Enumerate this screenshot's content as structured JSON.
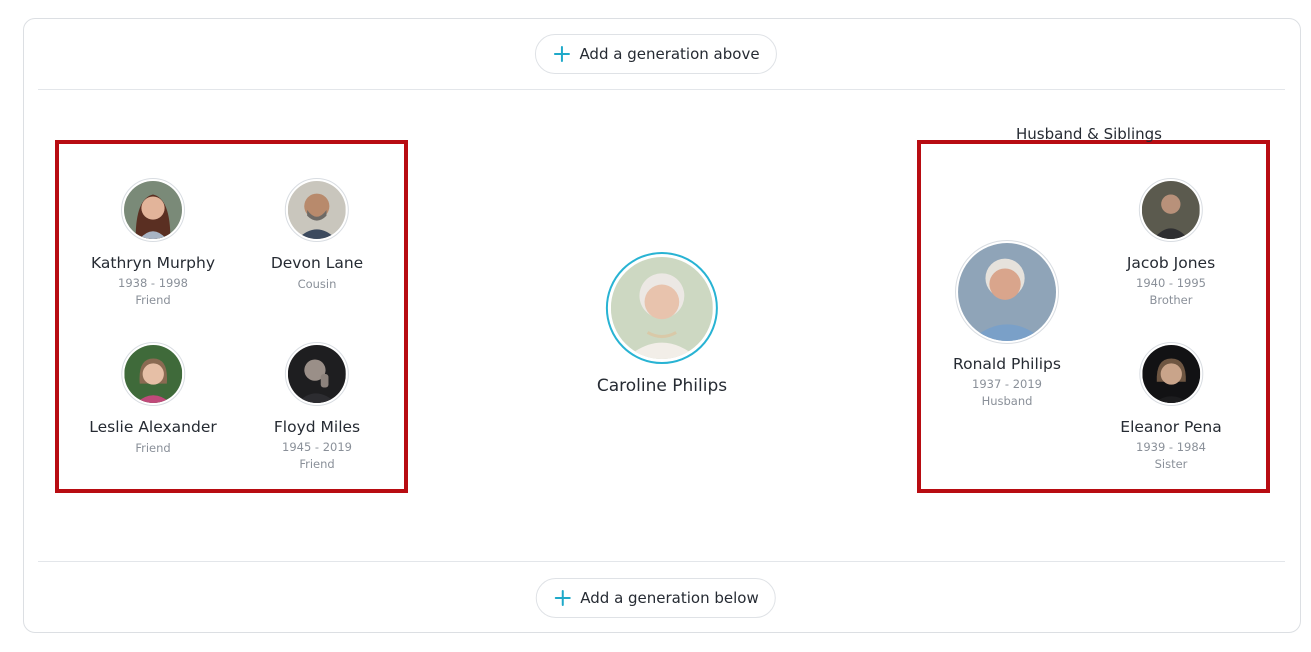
{
  "actions": {
    "add_above": "Add a generation above",
    "add_below": "Add a generation below"
  },
  "center_person": {
    "name": "Caroline Philips"
  },
  "right_group": {
    "title": "Husband & Siblings"
  },
  "people": {
    "kathryn": {
      "name": "Kathryn Murphy",
      "dates": "1938 - 1998",
      "relation": "Friend"
    },
    "devon": {
      "name": "Devon Lane",
      "dates": "",
      "relation": "Cousin"
    },
    "leslie": {
      "name": "Leslie Alexander",
      "dates": "",
      "relation": "Friend"
    },
    "floyd": {
      "name": "Floyd Miles",
      "dates": "1945 - 2019",
      "relation": "Friend"
    },
    "ronald": {
      "name": "Ronald Philips",
      "dates": "1937 - 2019",
      "relation": "Husband"
    },
    "jacob": {
      "name": "Jacob Jones",
      "dates": "1940 - 1995",
      "relation": "Brother"
    },
    "eleanor": {
      "name": "Eleanor Pena",
      "dates": "1939 - 1984",
      "relation": "Sister"
    }
  },
  "colors": {
    "accent": "#1fa9c9",
    "highlight": "#b80c12",
    "border": "#dcdfe3",
    "muted_text": "#8a9099"
  }
}
